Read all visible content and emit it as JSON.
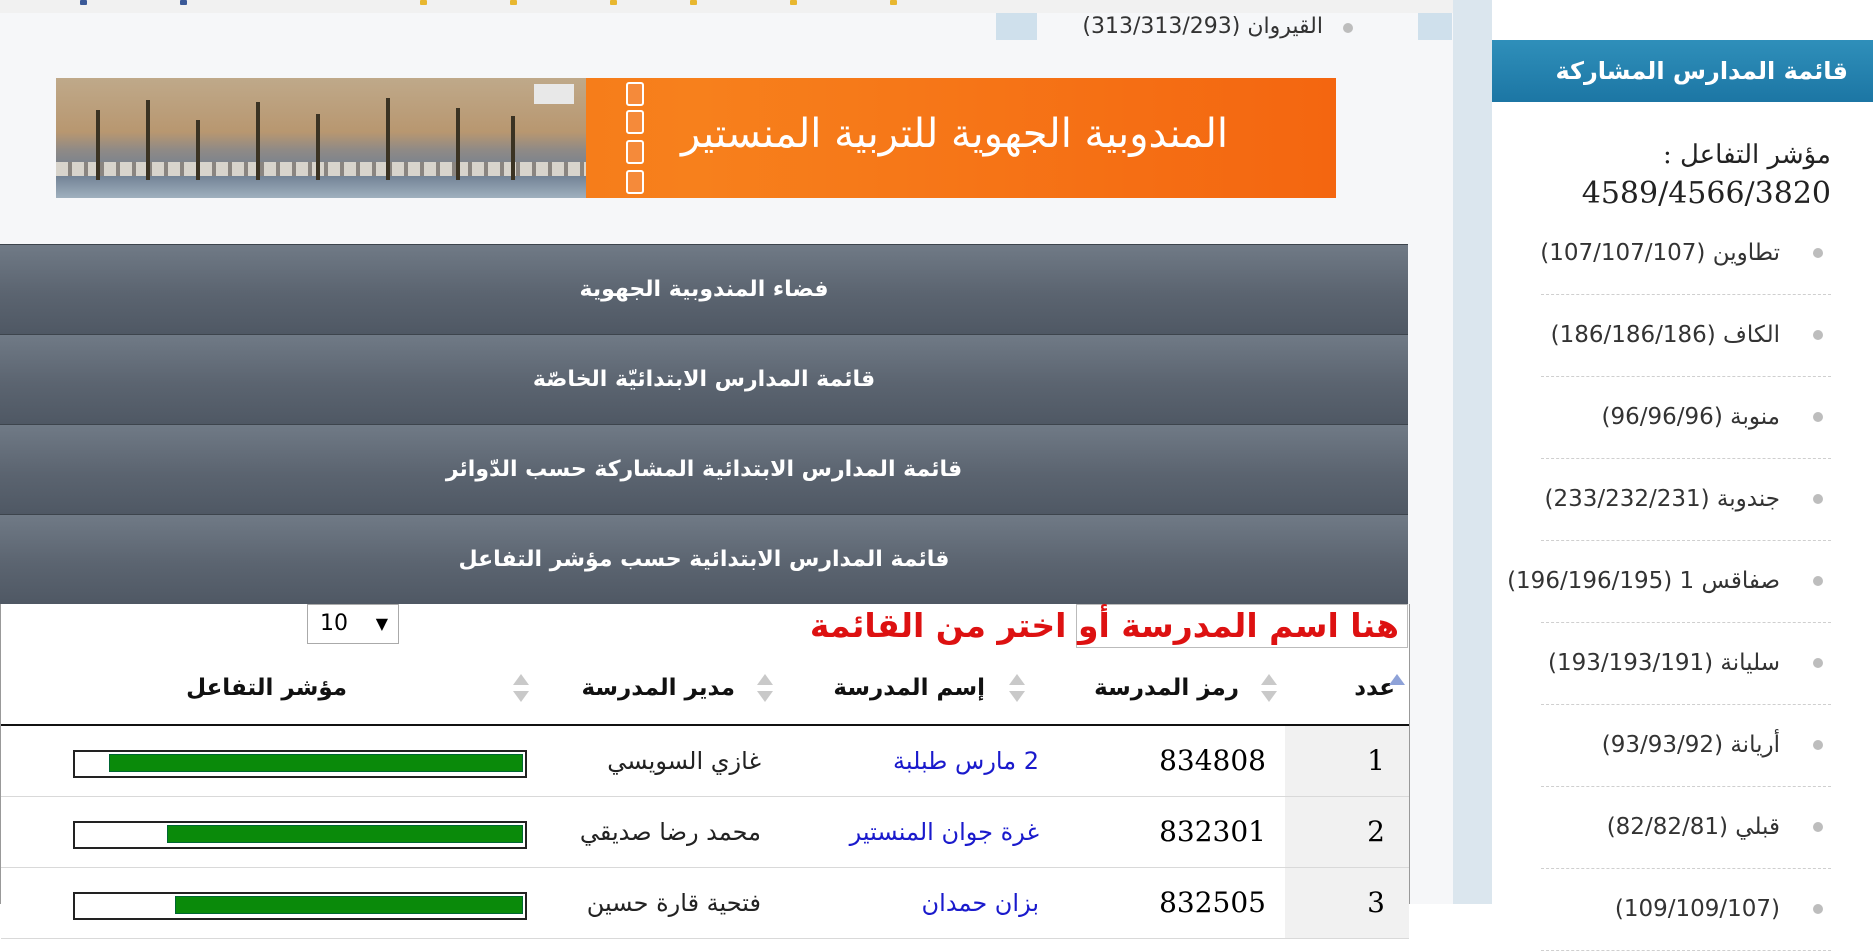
{
  "top_item": {
    "label": "القيروان (313/313/293)"
  },
  "banner": {
    "title": "المندوبية الجهوية للتربية المنستير"
  },
  "menu": [
    "فضاء المندوبية الجهوية",
    "قائمة المدارس الابتدائيّة الخاصّة",
    "قائمة المدارس الابتدائية المشاركة حسب الدّوائر",
    "قائمة المدارس الابتدائية حسب مؤشر التفاعل"
  ],
  "search": {
    "label": "هنا اسم المدرسة أو اختر من القائمة",
    "value": ""
  },
  "page_size": {
    "value": "10"
  },
  "table": {
    "headers": {
      "num": "عدد",
      "code": "رمز المدرسة",
      "school": "إسم المدرسة",
      "director": "مدير المدرسة",
      "index": "مؤشر التفاعل"
    },
    "rows": [
      {
        "num": "1",
        "code": "834808",
        "school": "2 مارس طبلبة",
        "director": "غازي السويسي",
        "fill": 0.93
      },
      {
        "num": "2",
        "code": "832301",
        "school": "غرة جوان المنستير",
        "director": "محمد رضا صديقي",
        "fill": 0.8
      },
      {
        "num": "3",
        "code": "832505",
        "school": "بزان حمدان",
        "director": "فتحية قارة حسين",
        "fill": 0.78
      }
    ]
  },
  "sidebar": {
    "title": "قائمة المدارس المشاركة",
    "metric_label": "مؤشر التفاعل :",
    "metric_value": "4589/4566/3820",
    "items": [
      "تطاوين (107/107/107)",
      "الكاف (186/186/186)",
      "منوبة (96/96/96)",
      "جندوبة (233/232/231)",
      "صفاقس 1 (196/196/195)",
      "سليانة (193/193/191)",
      "أريانة (93/93/92)",
      "قبلي (82/82/81)",
      "(109/109/107)"
    ]
  },
  "colors": {
    "sidebar_header": "#1c76a4",
    "menu_bg": "#5b6470",
    "bar_fill": "#0a8a0a",
    "search_label": "#dd1111",
    "link": "#1a1acc"
  }
}
